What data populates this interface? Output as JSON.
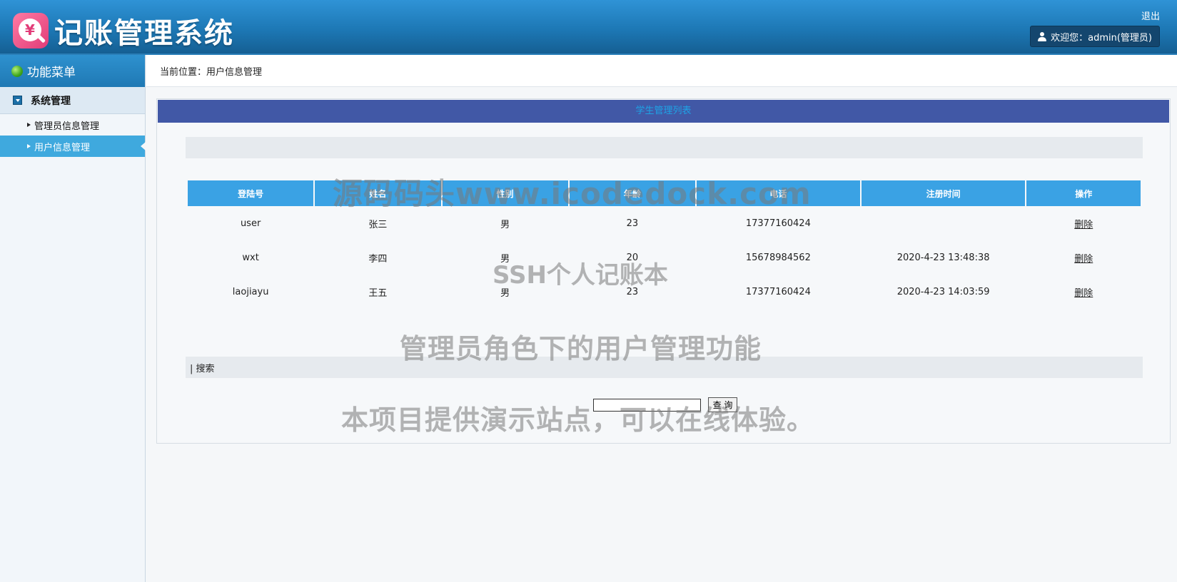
{
  "header": {
    "logo_symbol": "¥",
    "app_title": "记账管理系统",
    "logout_label": "退出",
    "welcome_text": "欢迎您：admin(管理员)"
  },
  "sidebar": {
    "title": "功能菜单",
    "group_label": "系统管理",
    "items": [
      {
        "label": "管理员信息管理",
        "active": false
      },
      {
        "label": "用户信息管理",
        "active": true
      }
    ]
  },
  "breadcrumb": "当前位置：用户信息管理",
  "panel": {
    "title": "学生管理列表"
  },
  "table": {
    "columns": [
      "登陆号",
      "姓名",
      "性别",
      "年龄",
      "电话",
      "注册时间",
      "操作"
    ],
    "rows": [
      {
        "login": "user",
        "name": "张三",
        "gender": "男",
        "age": "23",
        "phone": "17377160424",
        "registered": "",
        "action": "删除"
      },
      {
        "login": "wxt",
        "name": "李四",
        "gender": "男",
        "age": "20",
        "phone": "15678984562",
        "registered": "2020-4-23 13:48:38",
        "action": "删除"
      },
      {
        "login": "laojiayu",
        "name": "王五",
        "gender": "男",
        "age": "23",
        "phone": "17377160424",
        "registered": "2020-4-23 14:03:59",
        "action": "删除"
      }
    ]
  },
  "search": {
    "bar_label": "| 搜索",
    "input_value": "",
    "button_label": "查 询"
  },
  "watermarks": [
    "源码码头www.icodedock.com",
    "SSH个人记账本",
    "管理员角色下的用户管理功能",
    "本项目提供演示站点，可以在线体验。"
  ],
  "colors": {
    "header_blue": "#1d78b5",
    "panel_title_bg": "#4158a6",
    "table_header_bg": "#3aa2e4",
    "active_menu_bg": "#3fa9de"
  }
}
